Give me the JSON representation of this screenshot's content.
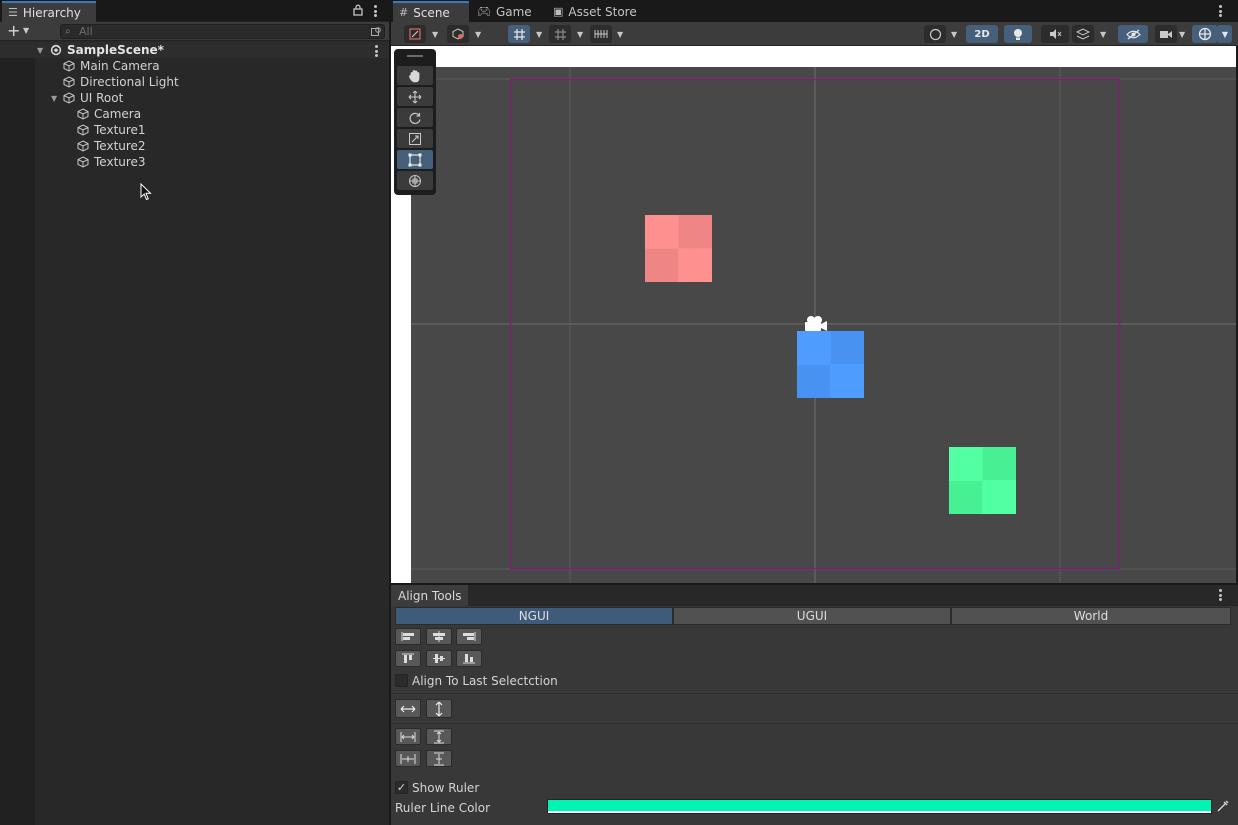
{
  "hierarchy": {
    "tab_label": "Hierarchy",
    "search_placeholder": "All",
    "scene_name": "SampleScene*",
    "items": [
      {
        "label": "Main Camera"
      },
      {
        "label": "Directional Light"
      },
      {
        "label": "UI Root"
      },
      {
        "label": "Camera"
      },
      {
        "label": "Texture1"
      },
      {
        "label": "Texture2"
      },
      {
        "label": "Texture3"
      }
    ]
  },
  "scene_view": {
    "tabs": [
      {
        "label": "Scene",
        "icon": "grid-icon"
      },
      {
        "label": "Game",
        "icon": "gamepad-icon"
      },
      {
        "label": "Asset Store",
        "icon": "bag-icon"
      }
    ],
    "toolbar_2d_label": "2D",
    "tools": [
      "hand-tool",
      "move-tool",
      "rotate-tool",
      "scale-tool",
      "rect-tool",
      "transform-tool"
    ],
    "active_tool": "rect-tool",
    "textures": [
      {
        "name": "Texture1",
        "color": "#ff8a8a"
      },
      {
        "name": "Texture2",
        "color": "#4d9bff"
      },
      {
        "name": "Texture3",
        "color": "#4dff9e"
      }
    ]
  },
  "align_tools": {
    "tab_label": "Align Tools",
    "modes": [
      {
        "label": "NGUI",
        "active": true
      },
      {
        "label": "UGUI",
        "active": false
      },
      {
        "label": "World",
        "active": false
      }
    ],
    "align_last_label": "Align To Last Selectction",
    "align_last_checked": false,
    "show_ruler_label": "Show Ruler",
    "show_ruler_checked": true,
    "ruler_color_label": "Ruler Line Color",
    "ruler_color": "#00f5b2"
  }
}
